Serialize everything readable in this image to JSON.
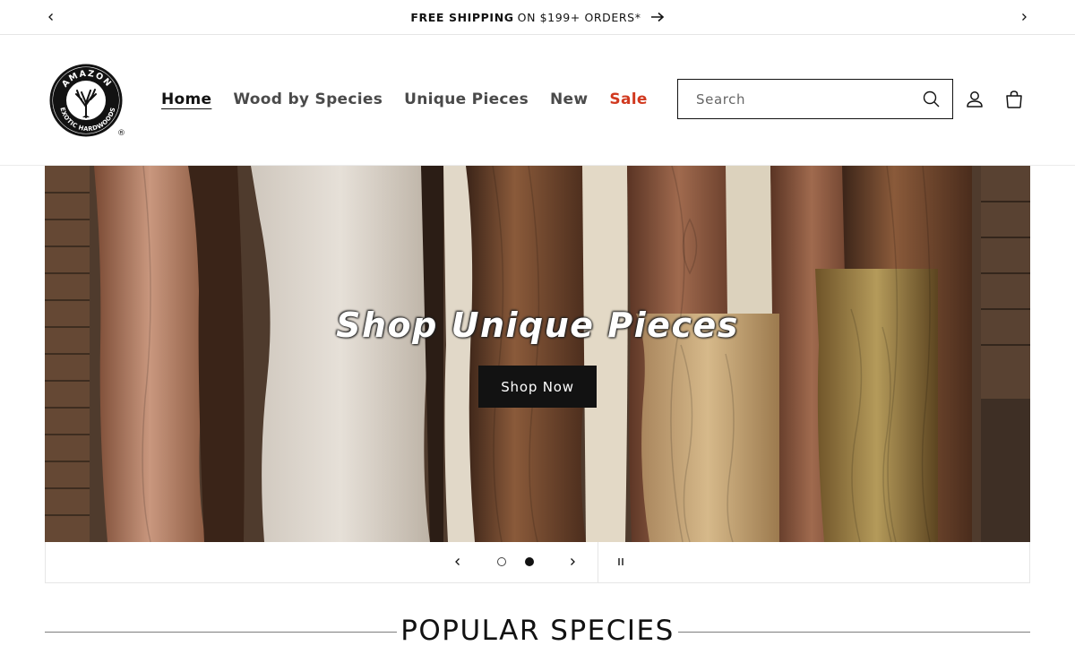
{
  "announcement": {
    "bold": "FREE SHIPPING",
    "rest": "ON $199+ ORDERS*"
  },
  "header": {
    "logo_top_text": "AMAZON",
    "logo_bottom_text": "EXOTIC HARDWOODS",
    "logo_mark": "®",
    "nav": [
      {
        "label": "Home"
      },
      {
        "label": "Wood by Species"
      },
      {
        "label": "Unique Pieces"
      },
      {
        "label": "New"
      },
      {
        "label": "Sale"
      }
    ],
    "search_placeholder": "Search"
  },
  "hero": {
    "heading": "Shop Unique Pieces",
    "button": "Shop Now",
    "slide_count": 2,
    "active_slide": 2
  },
  "section": {
    "title": "POPULAR SPECIES"
  },
  "icons": [
    "chevron-left-icon",
    "chevron-right-icon",
    "arrow-right-icon",
    "search-icon",
    "account-icon",
    "cart-icon",
    "pause-icon"
  ],
  "colors": {
    "sale": "#d1391f",
    "button": "#121212",
    "text": "#121212"
  }
}
